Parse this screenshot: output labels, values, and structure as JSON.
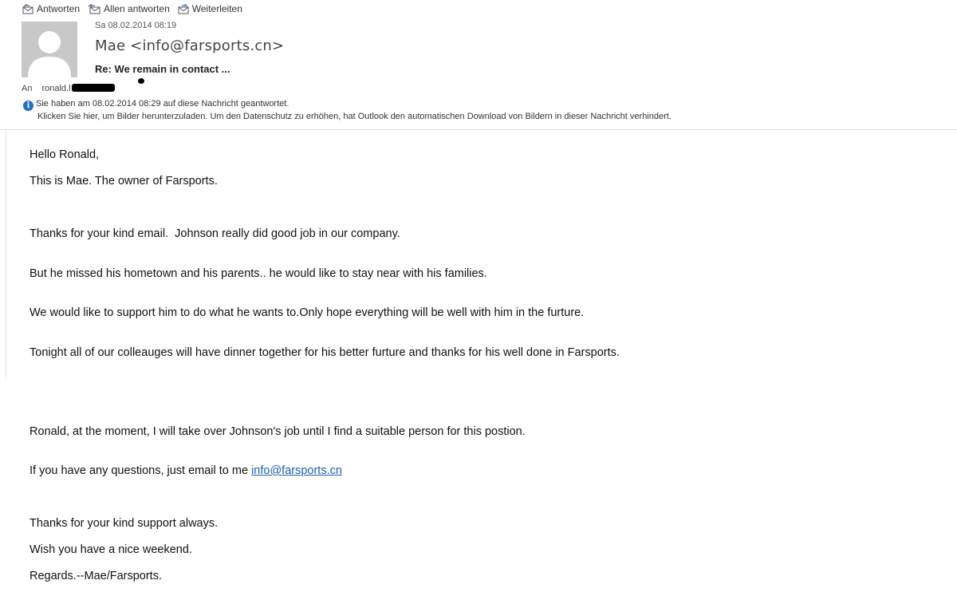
{
  "toolbar": {
    "reply_label": "Antworten",
    "reply_all_label": "Allen antworten",
    "forward_label": "Weiterleiten"
  },
  "header": {
    "date": "Sa 08.02.2014 08:19",
    "sender": "Mae <info@farsports.cn>",
    "subject": "Re: We remain in contact ...",
    "to_label": "An",
    "to_value": "ronald.l"
  },
  "infobar": {
    "replied_notice": "Sie haben am 08.02.2014 08:29 auf diese Nachricht geantwortet.",
    "images_notice": "Klicken Sie hier, um Bilder herunterzuladen. Um den Datenschutz zu erhöhen, hat Outlook den automatischen Download von Bildern in dieser Nachricht verhindert."
  },
  "message": {
    "greeting": "Hello Ronald,",
    "intro": "This is Mae. The owner of Farsports.",
    "p1_l1": "Thanks for your kind email.  Johnson really did good job in our company.",
    "p1_l2": "But he missed his hometown and his parents.. he would like to stay near with his families.",
    "p1_l3": "We would like to support him to do what he wants to.Only hope everything will be well with him in the furture.",
    "p1_l4": "Tonight all of our colleauges will have dinner together for his better furture and thanks for his well done in Farsports.",
    "p2_l1": "Ronald, at the moment, I will take over Johnson's job until I find a suitable person for this postion.",
    "p2_l2_prefix": "If you have any questions, just email to me ",
    "p2_l2_link": "info@farsports.cn",
    "thanks": "Thanks for your kind support always.",
    "wish": "Wish you have a nice weekend.",
    "regards": "Regards.--Mae/Farsports."
  }
}
